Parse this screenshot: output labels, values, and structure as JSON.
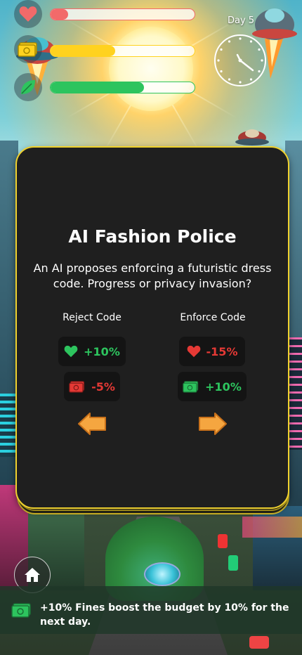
{
  "hud": {
    "stats": [
      {
        "name": "health",
        "icon": "heart-icon",
        "level": 0.12,
        "color": "#f26a6a"
      },
      {
        "name": "budget",
        "icon": "money-icon",
        "level": 0.45,
        "color": "#ffd21f"
      },
      {
        "name": "environment",
        "icon": "leaf-icon",
        "level": 0.65,
        "color": "#2dc45e"
      }
    ],
    "day_label": "Day 5",
    "clock_icon": "clock-icon"
  },
  "card": {
    "title": "AI Fashion Police",
    "description": "An AI proposes enforcing a futuristic dress code. Progress or privacy invasion?",
    "options": [
      {
        "label": "Reject Code",
        "direction": "left",
        "effects": [
          {
            "icon": "heart-icon",
            "value": "+10%",
            "color": "#2dc45e"
          },
          {
            "icon": "money-icon",
            "value": "-5%",
            "color": "#e53935"
          }
        ]
      },
      {
        "label": "Enforce Code",
        "direction": "right",
        "effects": [
          {
            "icon": "heart-icon",
            "value": "-15%",
            "color": "#e53935"
          },
          {
            "icon": "money-icon",
            "value": "+10%",
            "color": "#2dc45e"
          }
        ]
      }
    ]
  },
  "home_button": {
    "icon": "home-icon"
  },
  "toast": {
    "icon": "money-icon",
    "text": "+10% Fines boost the budget by 10% for the next day."
  }
}
